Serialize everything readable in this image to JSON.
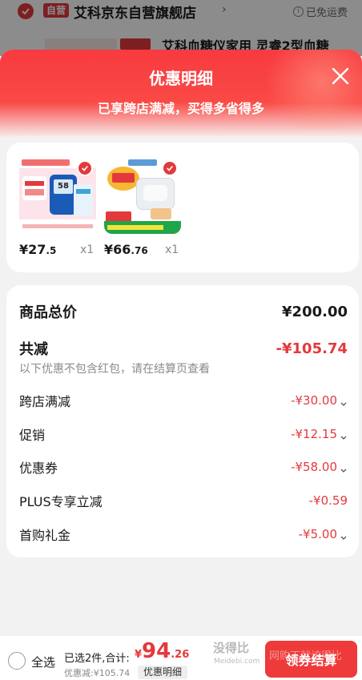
{
  "background": {
    "self_operated_tag": "自营",
    "store_name": "艾科京东自营旗舰店",
    "free_shipping": "已免运费",
    "product_title": "艾科血糖仪家用 灵睿2型血糖"
  },
  "sheet": {
    "title": "优惠明细",
    "subtitle": "已享跨店满减，买得多省得多"
  },
  "products": [
    {
      "price_int": "¥27",
      "price_dec": ".5",
      "qty": "x1",
      "meter_display": "58"
    },
    {
      "price_int": "¥66",
      "price_dec": ".76",
      "qty": "x1"
    }
  ],
  "summary": {
    "total_label": "商品总价",
    "total_value": "¥200.00",
    "discount_label": "共减",
    "discount_value": "-¥105.74",
    "note": "以下优惠不包含红包，请在结算页查看",
    "lines": [
      {
        "label": "跨店满减",
        "value": "-¥30.00",
        "expandable": true
      },
      {
        "label": "促销",
        "value": "-¥12.15",
        "expandable": true
      },
      {
        "label": "优惠券",
        "value": "-¥58.00",
        "expandable": true
      },
      {
        "label": "PLUS专享立减",
        "value": "-¥0.59",
        "expandable": false
      },
      {
        "label": "首购礼金",
        "value": "-¥5.00",
        "expandable": true
      }
    ]
  },
  "bottom": {
    "select_all": "全选",
    "selected_text": "已选2件,合计:",
    "total_symbol": "¥",
    "total_int": "94",
    "total_dec": ".26",
    "saved_text": "优惠减:¥105.74",
    "detail_button": "优惠明细",
    "checkout_button": "领券结算",
    "watermark_main": "没得比",
    "watermark_sub": "Meidebi.com",
    "watermark_overlay": "网购不就该得比"
  },
  "colors": {
    "accent_red": "#e4393c",
    "checkout_red": "#ee3a3a"
  }
}
